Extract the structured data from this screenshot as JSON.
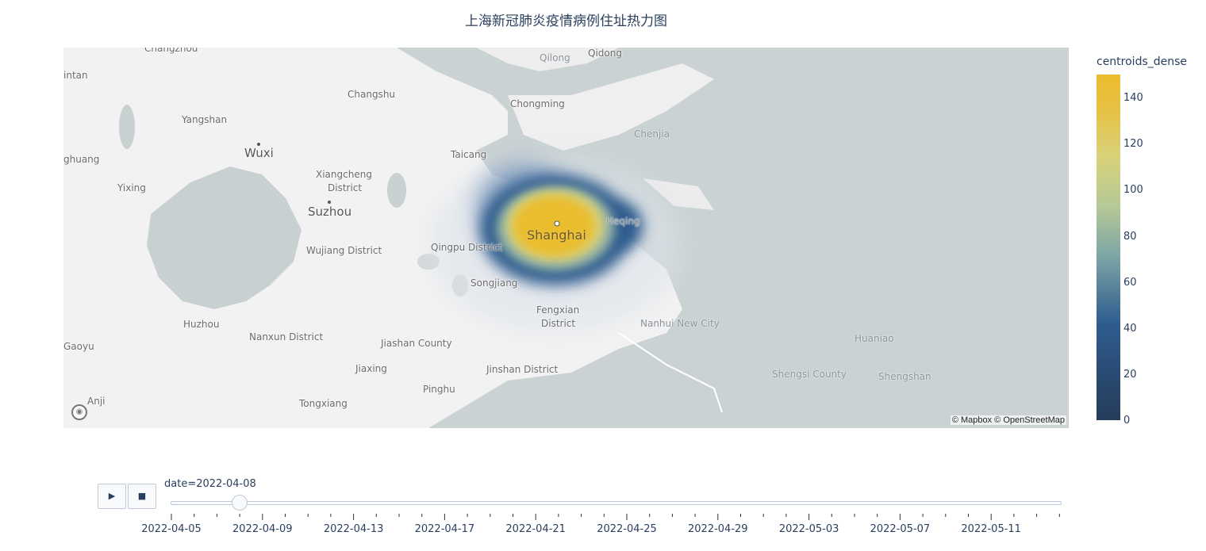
{
  "title": "上海新冠肺炎疫情病例住址热力图",
  "map": {
    "attribution": "© Mapbox © OpenStreetMap",
    "places": [
      {
        "name": "Changzhou",
        "cls": ""
      },
      {
        "name": "Qilong",
        "cls": "sea"
      },
      {
        "name": "Qidong",
        "cls": ""
      },
      {
        "name": "intan",
        "cls": ""
      },
      {
        "name": "Changshu",
        "cls": ""
      },
      {
        "name": "Chongming",
        "cls": ""
      },
      {
        "name": "Yangshan",
        "cls": ""
      },
      {
        "name": "Chenjia",
        "cls": "sea"
      },
      {
        "name": "Wuxi",
        "cls": "big"
      },
      {
        "name": "Taicang",
        "cls": ""
      },
      {
        "name": "ghuang",
        "cls": ""
      },
      {
        "name": "Xiangcheng",
        "cls": ""
      },
      {
        "name": "District",
        "cls": ""
      },
      {
        "name": "Yixing",
        "cls": ""
      },
      {
        "name": "Suzhou",
        "cls": "big"
      },
      {
        "name": "Heqing",
        "cls": "sea"
      },
      {
        "name": "Shanghai",
        "cls": "city-on-heat"
      },
      {
        "name": "Qingpu District",
        "cls": ""
      },
      {
        "name": "Wujiang District",
        "cls": ""
      },
      {
        "name": "Songjiang",
        "cls": ""
      },
      {
        "name": "Fengxian",
        "cls": ""
      },
      {
        "name": "District",
        "cls": ""
      },
      {
        "name": "Nanhui New City",
        "cls": "sea"
      },
      {
        "name": "Huzhou",
        "cls": ""
      },
      {
        "name": "Nanxun District",
        "cls": ""
      },
      {
        "name": "Jiashan County",
        "cls": ""
      },
      {
        "name": "Gaoyu",
        "cls": ""
      },
      {
        "name": "Huaniao",
        "cls": "sea"
      },
      {
        "name": "Jiaxing",
        "cls": ""
      },
      {
        "name": "Jinshan District",
        "cls": ""
      },
      {
        "name": "Shengsi County",
        "cls": "sea"
      },
      {
        "name": "Shengshan",
        "cls": "sea"
      },
      {
        "name": "Pinghu",
        "cls": ""
      },
      {
        "name": "Anji",
        "cls": ""
      },
      {
        "name": "Tongxiang",
        "cls": ""
      }
    ]
  },
  "colorbar": {
    "title": "centroids_dense",
    "ticks": [
      "140",
      "120",
      "100",
      "80",
      "60",
      "40",
      "20",
      "0"
    ],
    "range": [
      0,
      150
    ],
    "colors": [
      "#253c5a",
      "#2e5c8e",
      "#7fa7a6",
      "#b6c996",
      "#d8d27b",
      "#e7c143",
      "#eabd2e"
    ]
  },
  "controls": {
    "play_label": "▶",
    "stop_label": "■"
  },
  "slider": {
    "label": "date=2022-04-08",
    "date_labels": [
      "2022-04-05",
      "2022-04-09",
      "2022-04-13",
      "2022-04-17",
      "2022-04-21",
      "2022-04-25",
      "2022-04-29",
      "2022-05-03",
      "2022-05-07",
      "2022-05-11"
    ]
  }
}
